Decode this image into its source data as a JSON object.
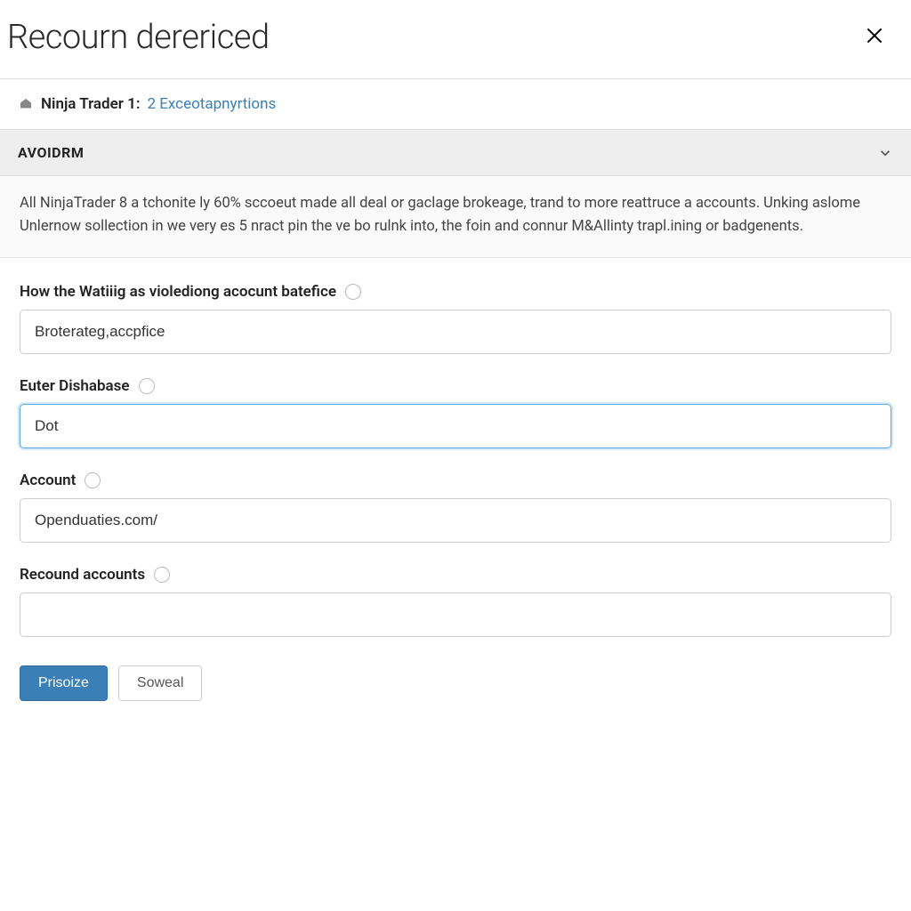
{
  "modal": {
    "title": "Recourn derericed",
    "close_icon": "close"
  },
  "breadcrumb": {
    "text": "Ninja Trader 1:",
    "link": "2 Exceotapnyrtions"
  },
  "section": {
    "header": "AVOIDRM",
    "body": "All NinjaTrader 8 a tchonite ly 60% sccoeut made all deal or gaclage brokeage, trand to more reattruce a accounts.  Unking aslome Unlernow sollection in we very es 5 nract pin the ve bo rulnk into, the foin and connur M&Allinty trapl.ining or badgenents."
  },
  "form": {
    "field1": {
      "label": "How the Watiiig as violediong acocunt batefice",
      "value": "Broterateg,accpfice"
    },
    "field2": {
      "label": "Euter Dishabase",
      "value": "Dot"
    },
    "field3": {
      "label": "Account",
      "value": "Openduaties.com/"
    },
    "field4": {
      "label": "Recound accounts",
      "value": ""
    }
  },
  "buttons": {
    "primary": "Prisoize",
    "secondary": "Soweal"
  }
}
